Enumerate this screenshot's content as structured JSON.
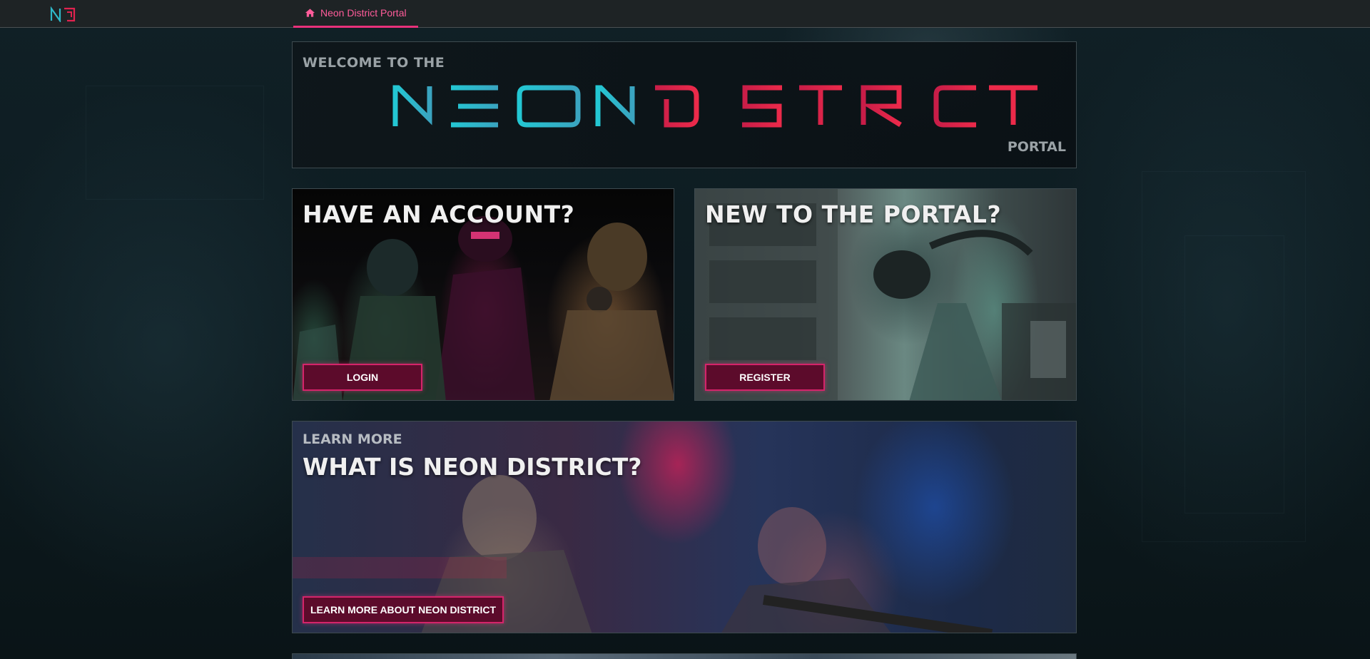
{
  "topbar": {
    "logo_icon": "nd-logo-icon",
    "nav_tab": {
      "label": "Neon District Portal",
      "icon": "home-icon",
      "active": true
    }
  },
  "welcome": {
    "pre": "WELCOME TO THE",
    "wordmark": {
      "part1": "NEON",
      "part2": "DISTRICT"
    },
    "post": "PORTAL"
  },
  "login_card": {
    "title": "HAVE AN ACCOUNT?",
    "button": "LOGIN"
  },
  "register_card": {
    "title": "NEW TO THE PORTAL?",
    "button": "REGISTER"
  },
  "learn_card": {
    "pre": "LEARN MORE",
    "title": "WHAT IS NEON DISTRICT?",
    "button": "LEARN MORE ABOUT NEON DISTRICT"
  },
  "colors": {
    "accent": "#e8317a",
    "button_bg": "#5c0b2b",
    "wordmark_cyan": "#2fb8c8",
    "wordmark_red": "#e0234f",
    "topbar_bg": "#1e2325"
  }
}
